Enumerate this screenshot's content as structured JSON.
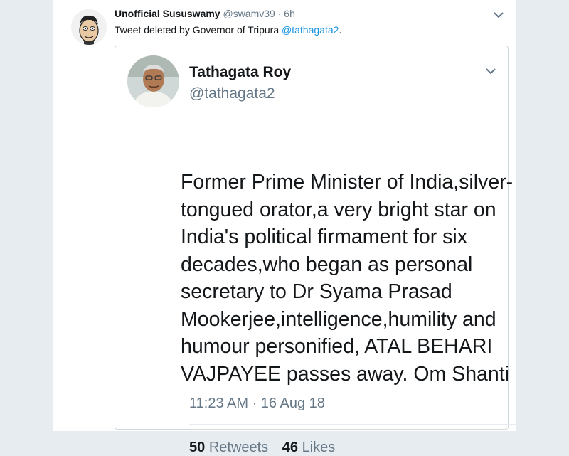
{
  "outer_tweet": {
    "display_name": "Unofficial Sususwamy",
    "handle": "@swamv39",
    "separator": "·",
    "time_ago": "6h",
    "text_prefix": "Tweet deleted by Governor of Tripura ",
    "mention": "@tathagata2",
    "text_suffix": "."
  },
  "quoted_tweet": {
    "display_name": "Tathagata Roy",
    "handle": "@tathagata2",
    "body_lines": [
      "Former Prime Minister of India,silver-",
      "tongued orator,a very bright star on",
      "India's political firmament for six",
      "decades,who began as personal",
      "secretary to Dr Syama Prasad",
      "Mookerjee,intelligence,humility and",
      "humour  personified, ATAL BEHARI",
      "VAJPAYEE passes away. Om Shanti"
    ],
    "timestamp": "11:23 AM · 16 Aug 18",
    "retweets_count": "50",
    "retweets_label": "Retweets",
    "likes_count": "46",
    "likes_label": "Likes"
  },
  "icons": {
    "outer_menu": "chevron-down-icon",
    "inner_menu": "chevron-down-icon"
  },
  "colors": {
    "link": "#1b95e0",
    "secondary_text": "#657786",
    "primary_text": "#14171a",
    "background": "#e6ecf0"
  }
}
